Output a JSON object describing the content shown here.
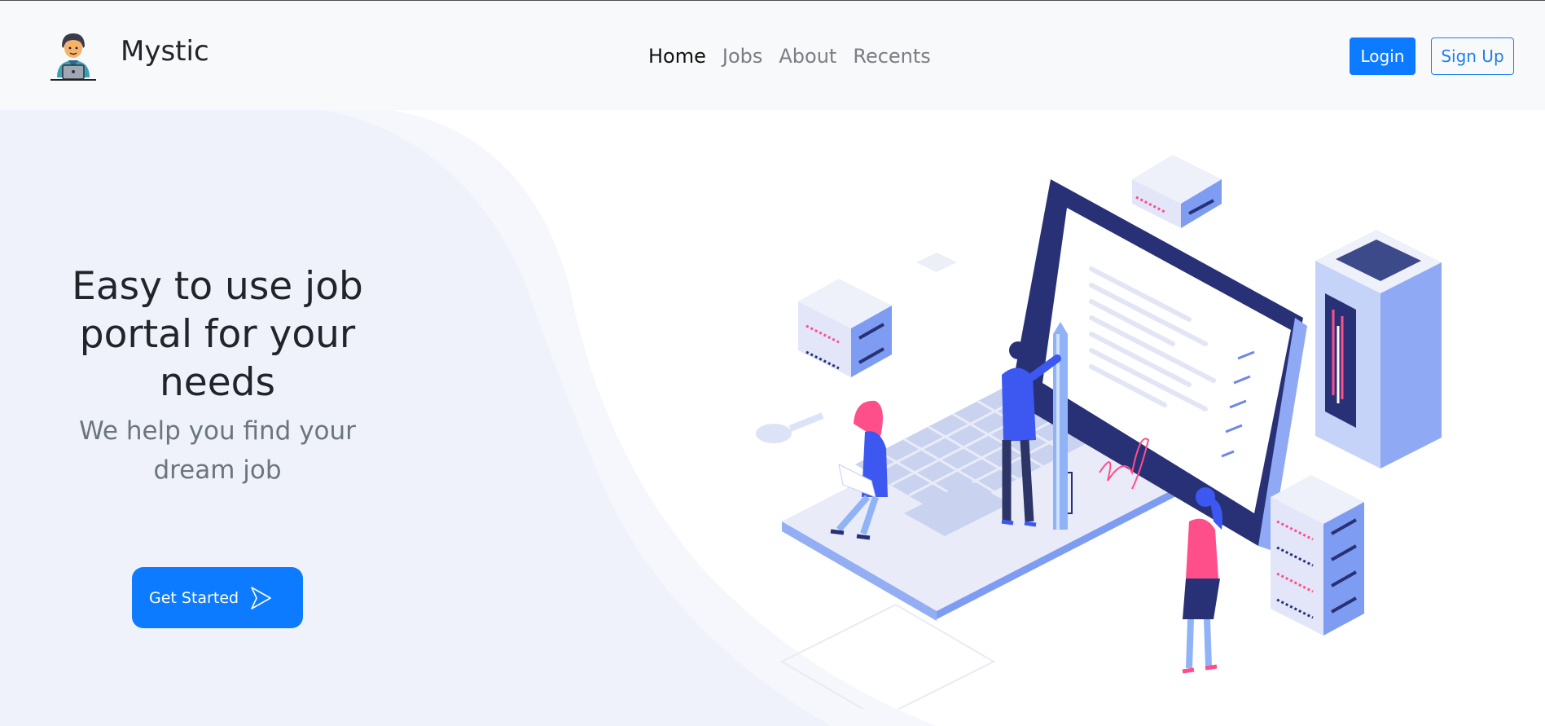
{
  "brand": {
    "name": "Mystic"
  },
  "nav": {
    "items": [
      {
        "label": "Home",
        "active": true
      },
      {
        "label": "Jobs",
        "active": false
      },
      {
        "label": "About",
        "active": false
      },
      {
        "label": "Recents",
        "active": false
      }
    ]
  },
  "auth": {
    "login_label": "Login",
    "signup_label": "Sign Up"
  },
  "hero": {
    "title": "Easy to use job portal for your needs",
    "subtitle": "We help you find your dream job",
    "cta_label": "Get Started"
  },
  "colors": {
    "primary": "#0d7bff",
    "navbar_bg": "#f8f9fa",
    "illustration_navy": "#283176",
    "illustration_blue": "#3d58f0",
    "illustration_pink": "#ff4f8b"
  },
  "icons": {
    "brand_logo": "user-at-laptop-icon",
    "cta_arrow": "play-arrow-icon"
  }
}
